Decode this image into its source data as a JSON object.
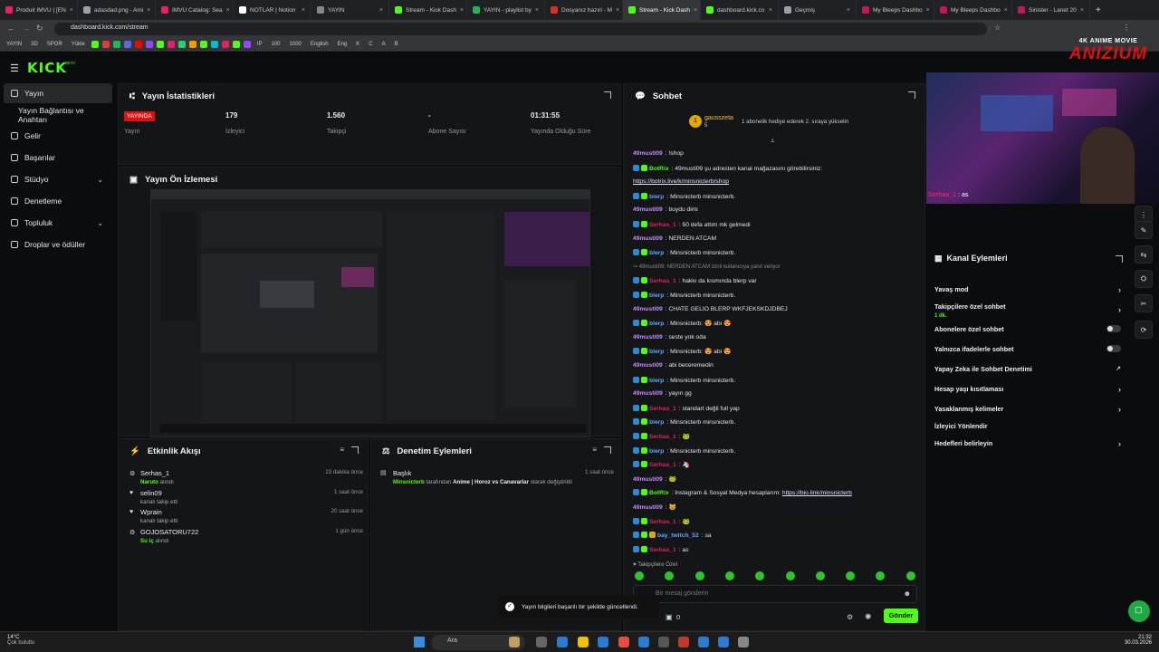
{
  "browser": {
    "tabs": [
      {
        "title": "Produit IMVU | [EN",
        "color": "#e91e63"
      },
      {
        "title": "adasdad.png - Ami",
        "color": "#9aa0a6"
      },
      {
        "title": "IMVU Catalog: Sea",
        "color": "#e91e63"
      },
      {
        "title": "NOTLAR | Notion",
        "color": "#ffffff"
      },
      {
        "title": "YAYIN",
        "color": "#888888"
      },
      {
        "title": "Stream - Kick Dash",
        "color": "#53fc18"
      },
      {
        "title": "YAYIN - playlist by",
        "color": "#1db954"
      },
      {
        "title": "Dosyanız hazırl - M",
        "color": "#d93025"
      },
      {
        "title": "Stream - Kick Dash",
        "color": "#53fc18",
        "active": true
      },
      {
        "title": "dashboard.kick.co",
        "color": "#53fc18"
      },
      {
        "title": "Geçmiş",
        "color": "#9aa0a6"
      },
      {
        "title": "My Bleeps Dashbo",
        "color": "#c2185b"
      },
      {
        "title": "My Bleeps Dashbo",
        "color": "#c2185b"
      },
      {
        "title": "Sinister - Lanet 20",
        "color": "#c2185b"
      }
    ],
    "url": "dashboard.kick.com/stream",
    "bookmarks": [
      "YAYIN",
      "3D",
      "SPOR",
      "Yükle",
      "IP",
      "100",
      "1000",
      "English",
      "Eng",
      "K",
      "C",
      "A",
      "B"
    ]
  },
  "kick": {
    "logo": "KICK",
    "logo_sup": "BETA",
    "sidebar": {
      "items": [
        {
          "label": "Yayın",
          "active": true,
          "icon": "broadcast-icon"
        },
        {
          "label": "Yayın Bağlantısı ve Anahtarı",
          "icon": ""
        },
        {
          "label": "Gelir",
          "icon": "money-icon"
        },
        {
          "label": "Başarılar",
          "icon": "trophy-icon"
        },
        {
          "label": "Stüdyo",
          "icon": "studio-icon",
          "chevron": true
        },
        {
          "label": "Denetleme",
          "icon": "shield-icon"
        },
        {
          "label": "Topluluk",
          "icon": "community-icon",
          "chevron": true
        },
        {
          "label": "Droplar ve ödüller",
          "icon": "gift-icon"
        }
      ]
    },
    "stats": {
      "title": "Yayın İstatistikleri",
      "live_badge": "YAYINDA",
      "items": [
        {
          "value": "",
          "label": "Yayın"
        },
        {
          "value": "179",
          "label": "İzleyici"
        },
        {
          "value": "1.560",
          "label": "Takipçi"
        },
        {
          "value": "-",
          "label": "Abone Sayısı"
        },
        {
          "value": "01:31:55",
          "label": "Yayında Olduğu Süre"
        }
      ]
    },
    "preview": {
      "title": "Yayın Ön İzlemesi"
    },
    "activity": {
      "title": "Etkinlik Akışı",
      "rows": [
        {
          "name": "Serhas_1",
          "sub_highlight": "Naruto",
          "sub": "alındı",
          "time": "23 dakika önce",
          "icon": "gift-icon"
        },
        {
          "name": "selin09",
          "sub_highlight": "",
          "sub": "kanalı takip etti",
          "time": "1 saat önce",
          "icon": "heart-icon"
        },
        {
          "name": "Wprain",
          "sub_highlight": "",
          "sub": "kanalı takip etti",
          "time": "20 saat önce",
          "icon": "heart-icon"
        },
        {
          "name": "GOJOSATORU722",
          "sub_highlight": "Su iç",
          "sub": "alındı",
          "time": "1 gün önce",
          "icon": "gift-icon"
        }
      ]
    },
    "moderation": {
      "title": "Denetim Eylemleri",
      "rows": [
        {
          "title": "Başlık",
          "user": "Minsnicterb",
          "text": "tarafından",
          "value": "Anime | Horoz vs Canavarlar",
          "tail": "olarak değiştirildi",
          "time": "1 saat önce"
        }
      ]
    },
    "chat": {
      "title": "Sohbet",
      "pinned_user": "gausszeta",
      "pinned_count": "5",
      "pinned_text": "1 abonelik hediye ederek 2. sıraya yükselin",
      "messages": [
        {
          "user": "49musti09",
          "color": "#c38cff",
          "text": "!shop",
          "badges": 0
        },
        {
          "user": "BotRix",
          "color": "#53fc18",
          "text": "49musti09 şu adresten kanal mağazasını görebilirsiniz:",
          "badges": 2
        },
        {
          "user": "",
          "color": "#ffffff",
          "link": "https://botrix.live/k/minsnicterb/shop",
          "text": "",
          "badges": 0
        },
        {
          "user": "blerp",
          "color": "#5fa8ff",
          "text": "Minsnicterb minsnicterb.",
          "badges": 2
        },
        {
          "user": "49musti09",
          "color": "#c38cff",
          "text": "buydu dimi",
          "badges": 0
        },
        {
          "user": "Serhas_1",
          "color": "#e0245e",
          "text": "50 defa attım mk gelmedi",
          "badges": 2
        },
        {
          "user": "49musti09",
          "color": "#c38cff",
          "text": "NERDEN ATCAM",
          "badges": 0
        },
        {
          "user": "blerp",
          "color": "#5fa8ff",
          "text": "Minsnicterb minsnicterb.",
          "badges": 2
        },
        {
          "user": "",
          "color": "#8a8a8a",
          "text": "↪ 49musti09: NERDEN ATCAM izinli kullanıcıya yanıt veriyor",
          "badges": 0,
          "reply": true
        },
        {
          "user": "Serhas_1",
          "color": "#e0245e",
          "text": "hakkı da kısmında blerp var",
          "badges": 2
        },
        {
          "user": "blerp",
          "color": "#5fa8ff",
          "text": "Minsnicterb minsnicterb.",
          "badges": 2
        },
        {
          "user": "49musti09",
          "color": "#c38cff",
          "text": "CHATE GELİO BLERP WKFJEKSKDJDBEJ",
          "badges": 0
        },
        {
          "user": "blerp",
          "color": "#5fa8ff",
          "text": "Minsnicterb: 😍 abi 😍",
          "badges": 2
        },
        {
          "user": "49musti09",
          "color": "#c38cff",
          "text": "seste yok oda",
          "badges": 0
        },
        {
          "user": "blerp",
          "color": "#5fa8ff",
          "text": "Minsnicterb: 😍 abi 😍",
          "badges": 2
        },
        {
          "user": "49musti09",
          "color": "#c38cff",
          "text": "abi beceremedin",
          "badges": 0
        },
        {
          "user": "blerp",
          "color": "#5fa8ff",
          "text": "Minsnicterb minsnicterb.",
          "badges": 2
        },
        {
          "user": "49musti09",
          "color": "#c38cff",
          "text": "yayın gg",
          "badges": 0
        },
        {
          "user": "Serhas_1",
          "color": "#e0245e",
          "text": "standart değil full yap",
          "badges": 2
        },
        {
          "user": "blerp",
          "color": "#5fa8ff",
          "text": "Minsnicterb minsnicterb.",
          "badges": 2
        },
        {
          "user": "Serhas_1",
          "color": "#e0245e",
          "text": "🐸",
          "badges": 2
        },
        {
          "user": "blerp",
          "color": "#5fa8ff",
          "text": "Minsnicterb minsnicterb.",
          "badges": 2
        },
        {
          "user": "Serhas_1",
          "color": "#e0245e",
          "text": "🦄",
          "badges": 2
        },
        {
          "user": "49musti09",
          "color": "#c38cff",
          "text": "🐸",
          "badges": 0
        },
        {
          "user": "BotRix",
          "color": "#53fc18",
          "text": "Instagram & Sosyal Medya hesaplarım:",
          "link": "https://bio.link/minsnicterb",
          "badges": 2
        },
        {
          "user": "49musti09",
          "color": "#c38cff",
          "text": "🐱",
          "badges": 0
        },
        {
          "user": "Serhas_1",
          "color": "#e0245e",
          "text": "🐸",
          "badges": 2
        },
        {
          "user": "bay_twitch_52",
          "color": "#5fa8ff",
          "text": "sa",
          "badges": 3
        },
        {
          "user": "Serhas_1",
          "color": "#e0245e",
          "text": "as",
          "badges": 2
        }
      ],
      "followers_only_label": "♥ Takipçilere Özel",
      "input_placeholder": "Bir mesaj gönderin",
      "count": "0",
      "send_label": "Gönder"
    },
    "channel_actions": {
      "title": "Kanal Eylemleri",
      "rows": [
        {
          "label": "Yavaş mod",
          "control": "arrow"
        },
        {
          "label": "Takipçilere özel sohbet",
          "sub": "1 dk.",
          "control": "arrow"
        },
        {
          "label": "Abonelere özel sohbet",
          "control": "toggle"
        },
        {
          "label": "Yalnızca ifadelerle sohbet",
          "control": "toggle"
        },
        {
          "label": "Yapay Zeka ile Sohbet Denetimi",
          "control": "ext"
        },
        {
          "label": "Hesap yaşı kısıtlaması",
          "control": "arrow"
        },
        {
          "label": "Yasaklanmış kelimeler",
          "control": "arrow"
        },
        {
          "label": "İzleyici Yönlendir",
          "control": ""
        },
        {
          "label": "Hedefleri belirleyin",
          "control": "arrow"
        }
      ]
    },
    "toast": "Yayın bilgileri başarılı bir şekilde güncellendi.",
    "webcam": {
      "overlay_user": "Serhas_1",
      "overlay_text": "as",
      "brand_sub": "4K ANIME MOVIE",
      "brand": "ANIZIUM"
    }
  },
  "taskbar": {
    "weather_temp": "14°C",
    "weather_text": "Çok bulutlu",
    "search_placeholder": "Ara",
    "time": "21:32",
    "date": "30.03.2026"
  },
  "colors": {
    "accent": "#53fc18",
    "live": "#dd1111",
    "panel": "#141517"
  }
}
